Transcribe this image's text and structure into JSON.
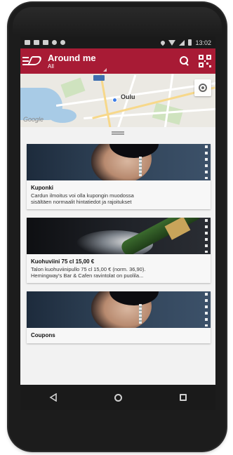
{
  "status_bar": {
    "time": "13:02"
  },
  "app_bar": {
    "title": "Around me",
    "subtitle": "All"
  },
  "map": {
    "city_label": "Oulu",
    "attribution": "Google"
  },
  "offers": [
    {
      "title": "Kuponki",
      "line1": "Cardun ilmoitus voi olla kupongin muodossa",
      "line2": "sisältäen normaalit hintatiedot ja rajoitukset"
    },
    {
      "title": "Kuohuviini 75 cl 15,00 €",
      "line1": "Talon kuohuviinipullo 75 cl 15,00 € (norm. 36,90).",
      "line2": "Hemingway's Bar & Cafen ravintolat on puolila..."
    },
    {
      "title": "Coupons",
      "line1": "",
      "line2": ""
    }
  ],
  "colors": {
    "app_bar": "#a81b35",
    "status_bar": "#1a1a1a"
  }
}
